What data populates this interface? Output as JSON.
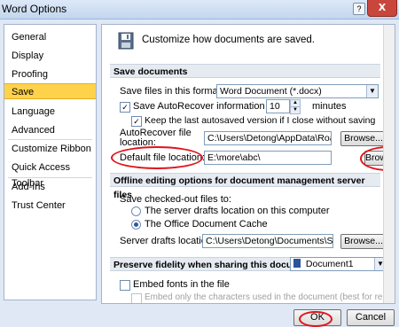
{
  "window": {
    "title": "Word Options",
    "help": "?",
    "close": "X"
  },
  "sidebar": {
    "items": [
      {
        "label": "General"
      },
      {
        "label": "Display"
      },
      {
        "label": "Proofing"
      },
      {
        "label": "Save"
      },
      {
        "label": "Language"
      },
      {
        "label": "Advanced"
      },
      {
        "label": "Customize Ribbon"
      },
      {
        "label": "Quick Access Toolbar"
      },
      {
        "label": "Add-Ins"
      },
      {
        "label": "Trust Center"
      }
    ]
  },
  "main": {
    "header": "Customize how documents are saved.",
    "save_documents": {
      "heading": "Save documents",
      "format_label": "Save files in this format:",
      "format_value": "Word Document (*.docx)",
      "autorecover_label": "Save AutoRecover information every",
      "autorecover_value": "10",
      "autorecover_unit": "minutes",
      "keep_last_label": "Keep the last autosaved version if I close without saving",
      "autorecover_location_label1": "AutoRecover file",
      "autorecover_location_label2": "location:",
      "autorecover_location_value": "C:\\Users\\Detong\\AppData\\Roaming\\",
      "default_location_label": "Default file location:",
      "default_location_value": "E:\\more\\abc\\",
      "browse_label": "Browse..."
    },
    "offline": {
      "heading": "Offline editing options for document management server files",
      "save_checked_out_label": "Save checked-out files to:",
      "option_server": "The server drafts location on this computer",
      "option_cache": "The Office Document Cache",
      "drafts_location_label": "Server drafts location:",
      "drafts_location_value": "C:\\Users\\Detong\\Documents\\SharePo",
      "browse_label": "Browse..."
    },
    "fidelity": {
      "heading": "Preserve fidelity when sharing this document:",
      "document_value": "Document1",
      "embed_fonts_label": "Embed fonts in the file",
      "embed_chars_label": "Embed only the characters used in the document (best for reducing"
    }
  },
  "footer": {
    "ok": "OK",
    "cancel": "Cancel"
  },
  "colors": {
    "highlight_red": "#e0141c",
    "active_item": "#ffd24c"
  }
}
